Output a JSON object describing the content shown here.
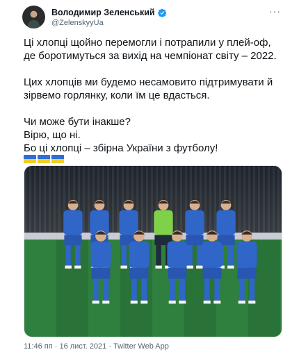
{
  "author": {
    "display_name": "Володимир Зеленський",
    "handle": "@ZelenskyyUa",
    "verified_icon": "verified-badge-icon",
    "more_icon": "more-options-icon"
  },
  "tweet": {
    "lines": [
      "Ці хлопці щойно перемогли і потрапили у плей-оф,",
      "де боротимуться за вихід на чемпіонат світу – 2022.",
      "",
      "Цих хлопців ми будемо несамовито підтримувати й",
      "зірвемо горлянку, коли їм це вдасться.",
      "",
      "Чи може бути інакше?",
      "Вірю, що ні.",
      "Бо ці хлопці – збірна України з футболу!"
    ],
    "flag_count": 3,
    "flag_colors": {
      "blue": "#2f6fd0",
      "yellow": "#f5cf1e"
    }
  },
  "photo": {
    "kit_color": "#2f66c8",
    "keeper_color": "#7fd14a"
  },
  "footer": {
    "timestamp": "11:46 пп · 16 лист. 2021 · Twitter Web App"
  }
}
